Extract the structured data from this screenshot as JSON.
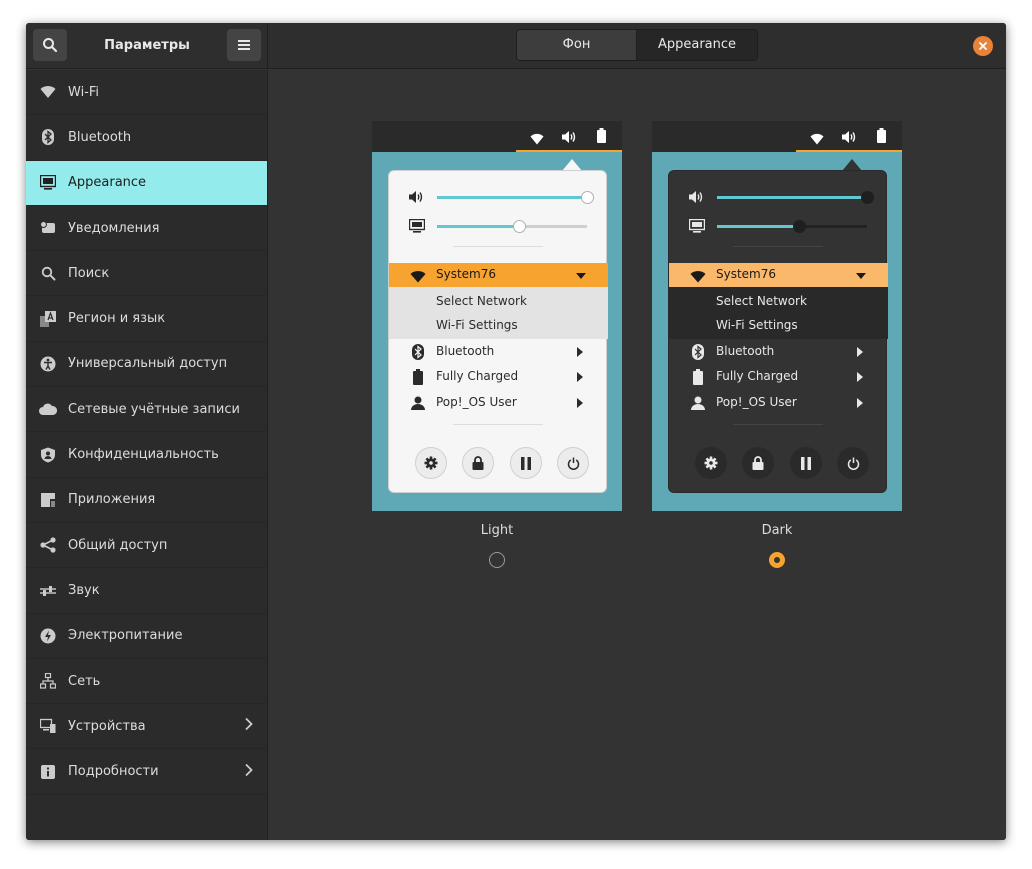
{
  "header": {
    "title": "Параметры",
    "search_icon": "search-icon",
    "menu_icon": "hamburger-menu-icon",
    "tabs": [
      {
        "label": "Фон",
        "active": false
      },
      {
        "label": "Appearance",
        "active": true
      }
    ],
    "close_icon": "close-icon"
  },
  "sidebar": {
    "items": [
      {
        "label": "Wi-Fi",
        "icon": "wifi-icon"
      },
      {
        "label": "Bluetooth",
        "icon": "bluetooth-icon"
      },
      {
        "label": "Appearance",
        "icon": "appearance-icon",
        "selected": true
      },
      {
        "label": "Уведомления",
        "icon": "notifications-icon"
      },
      {
        "label": "Поиск",
        "icon": "search-icon"
      },
      {
        "label": "Регион и язык",
        "icon": "region-language-icon"
      },
      {
        "label": "Универсальный доступ",
        "icon": "accessibility-icon"
      },
      {
        "label": "Сетевые учётные записи",
        "icon": "cloud-icon"
      },
      {
        "label": "Конфиденциальность",
        "icon": "privacy-icon"
      },
      {
        "label": "Приложения",
        "icon": "applications-icon"
      },
      {
        "label": "Общий доступ",
        "icon": "share-icon"
      },
      {
        "label": "Звук",
        "icon": "sound-icon"
      },
      {
        "label": "Электропитание",
        "icon": "power-icon"
      },
      {
        "label": "Сеть",
        "icon": "network-icon"
      },
      {
        "label": "Устройства",
        "icon": "devices-icon",
        "has_chevron": true
      },
      {
        "label": "Подробности",
        "icon": "info-icon",
        "has_chevron": true
      }
    ]
  },
  "themes": {
    "light": {
      "caption": "Light",
      "selected": false,
      "volume_level": 1.0,
      "brightness_level": 0.55,
      "wifi_network": "System76",
      "select_network": "Select Network",
      "wifi_settings": "Wi-Fi Settings",
      "bluetooth": "Bluetooth",
      "battery": "Fully Charged",
      "user": "Pop!_OS User"
    },
    "dark": {
      "caption": "Dark",
      "selected": true,
      "volume_level": 1.0,
      "brightness_level": 0.55,
      "wifi_network": "System76",
      "select_network": "Select Network",
      "wifi_settings": "Wi-Fi Settings",
      "bluetooth": "Bluetooth",
      "battery": "Fully Charged",
      "user": "Pop!_OS User"
    }
  },
  "colors": {
    "accent_selected": "#94ebeb",
    "accent_orange": "#f6a330",
    "close_orange": "#e8833a",
    "preview_bg": "#5fa9b6",
    "slider_fill": "#5fc8d0"
  }
}
